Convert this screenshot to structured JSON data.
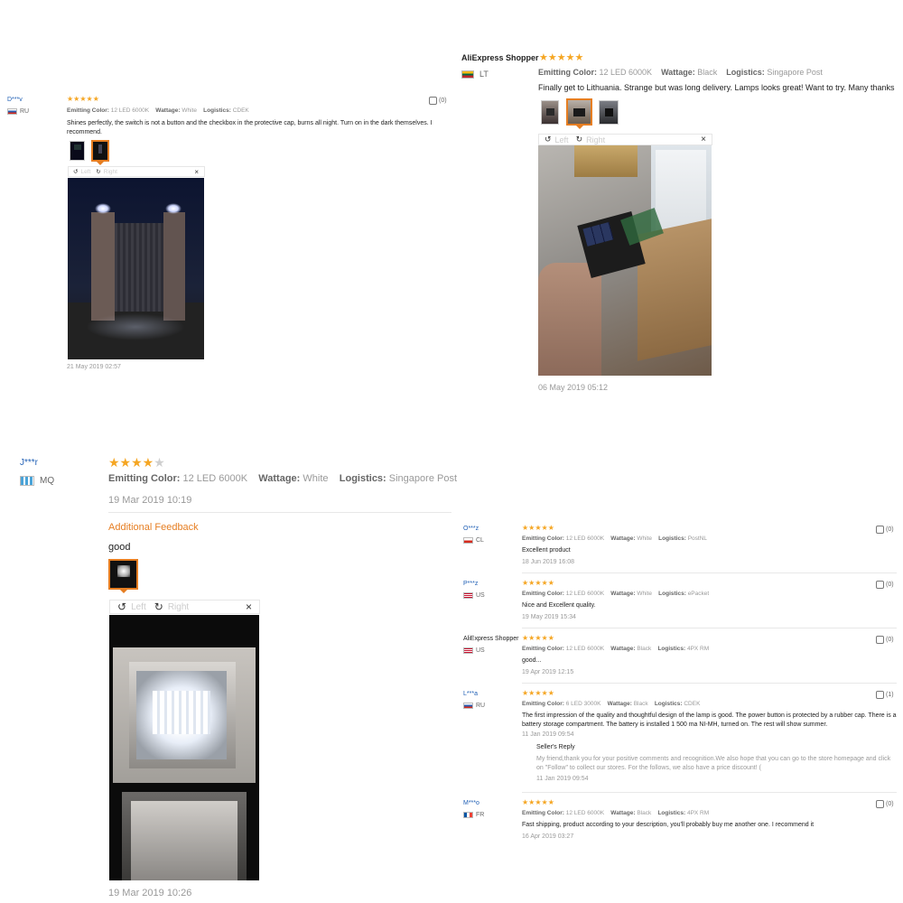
{
  "review_tl": {
    "username": "D***v",
    "country": "RU",
    "stars": "★★★★★",
    "likes": "(0)",
    "emitting_label": "Emitting Color:",
    "emitting": "12 LED 6000K",
    "wattage_label": "Wattage:",
    "wattage": "White",
    "logistics_label": "Logistics:",
    "logistics": "CDEK",
    "text": "Shines perfectly, the switch is not a button and the checkbox in the protective cap, burns all night. Turn on in the dark themselves. I recommend.",
    "viewer_left": "Left",
    "viewer_right": "Right",
    "close": "×",
    "date": "21 May 2019 02:57"
  },
  "review_tr": {
    "username": "AliExpress Shopper",
    "country": "LT",
    "stars": "★★★★★",
    "emitting_label": "Emitting Color:",
    "emitting": "12 LED 6000K",
    "wattage_label": "Wattage:",
    "wattage": "Black",
    "logistics_label": "Logistics:",
    "logistics": "Singapore Post",
    "text": "Finally get to Lithuania. Strange but was long delivery. Lamps looks great! Want to try. Many thanks",
    "viewer_left": "Left",
    "viewer_right": "Right",
    "close": "×",
    "date": "06 May 2019 05:12"
  },
  "review_bl": {
    "username": "J***r",
    "country": "MQ",
    "stars_on": "★★★★",
    "stars_off": "★",
    "emitting_label": "Emitting Color:",
    "emitting": "12 LED 6000K",
    "wattage_label": "Wattage:",
    "wattage": "White",
    "logistics_label": "Logistics:",
    "logistics": "Singapore Post",
    "date1": "19 Mar 2019 10:19",
    "additional_label": "Additional Feedback",
    "text": "good",
    "viewer_left": "Left",
    "viewer_right": "Right",
    "close": "×",
    "date2": "19 Mar 2019 10:26"
  },
  "review_list": [
    {
      "username": "O***z",
      "country": "CL",
      "stars": "★★★★★",
      "emitting": "12 LED 6000K",
      "wattage": "White",
      "logistics": "PostNL",
      "text": "Excellent product",
      "date": "18 Jun 2019 16:08",
      "likes": "(0)"
    },
    {
      "username": "P***z",
      "country": "US",
      "stars": "★★★★★",
      "emitting": "12 LED 6000K",
      "wattage": "White",
      "logistics": "ePacket",
      "text": "Nice and Excellent quality.",
      "date": "19 May 2019 15:34",
      "likes": "(0)"
    },
    {
      "username": "AliExpress Shopper",
      "country": "US",
      "stars": "★★★★★",
      "emitting": "12 LED 6000K",
      "wattage": "Black",
      "logistics": "4PX RM",
      "text": "good...",
      "date": "19 Apr 2019 12:15",
      "likes": "(0)"
    },
    {
      "username": "L***a",
      "country": "RU",
      "stars": "★★★★★",
      "emitting": "6 LED 3000K",
      "wattage": "Black",
      "logistics": "CDEK",
      "text": "The first impression of the quality and thoughtful design of the lamp is good. The power button is protected by a rubber cap. There is a battery storage compartment. The battery is installed 1 500 ma NI-MH, turned on. The rest will show summer.",
      "date": "11 Jan 2019 09:54",
      "likes": "(1)",
      "seller_reply_label": "Seller's Reply",
      "seller_reply": "My friend,thank you for your positive comments and recognition.We also hope that you can go to the store homepage and click on \"Follow\" to collect our stores. For the follows, we also have a price discount! (",
      "seller_reply_date": "11 Jan 2019 09:54"
    },
    {
      "username": "M***o",
      "country": "FR",
      "stars": "★★★★★",
      "emitting": "12 LED 6000K",
      "wattage": "Black",
      "logistics": "4PX RM",
      "text": "Fast shipping, product according to your description, you'll probably buy me another one. I recommend it",
      "date": "16 Apr 2019 03:27",
      "likes": "(0)"
    }
  ],
  "labels": {
    "emitting": "Emitting Color:",
    "wattage": "Wattage:",
    "logistics": "Logistics:"
  },
  "colors": {
    "star": "#f5a623",
    "username": "#1f5fb5",
    "accent": "#e67e22"
  }
}
